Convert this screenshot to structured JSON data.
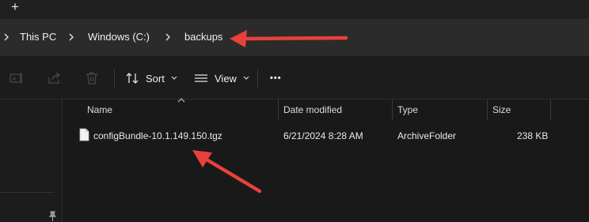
{
  "tabstrip": {
    "new_tab_icon": "plus-icon"
  },
  "breadcrumb": {
    "items": [
      {
        "label": "This PC"
      },
      {
        "label": "Windows (C:)"
      },
      {
        "label": "backups"
      }
    ],
    "separator_icon": "chevron-right-icon"
  },
  "commandbar": {
    "rename_icon": "rename-icon",
    "share_icon": "share-icon",
    "delete_icon": "trash-icon",
    "sort_label": "Sort",
    "view_label": "View",
    "more_label": "•••"
  },
  "filelist": {
    "columns": [
      {
        "label": "Name"
      },
      {
        "label": "Date modified"
      },
      {
        "label": "Type"
      },
      {
        "label": "Size"
      }
    ],
    "sorted_column": "Name",
    "rows": [
      {
        "name": "configBundle-10.1.149.150.tgz",
        "date_modified": "6/21/2024 8:28 AM",
        "type": "ArchiveFolder",
        "size": "238 KB"
      }
    ]
  },
  "annotations": {
    "arrow_color": "#e8413c"
  },
  "colors": {
    "background": "#191919",
    "address_bar": "#2b2b2b",
    "text": "#f0f0f0"
  }
}
